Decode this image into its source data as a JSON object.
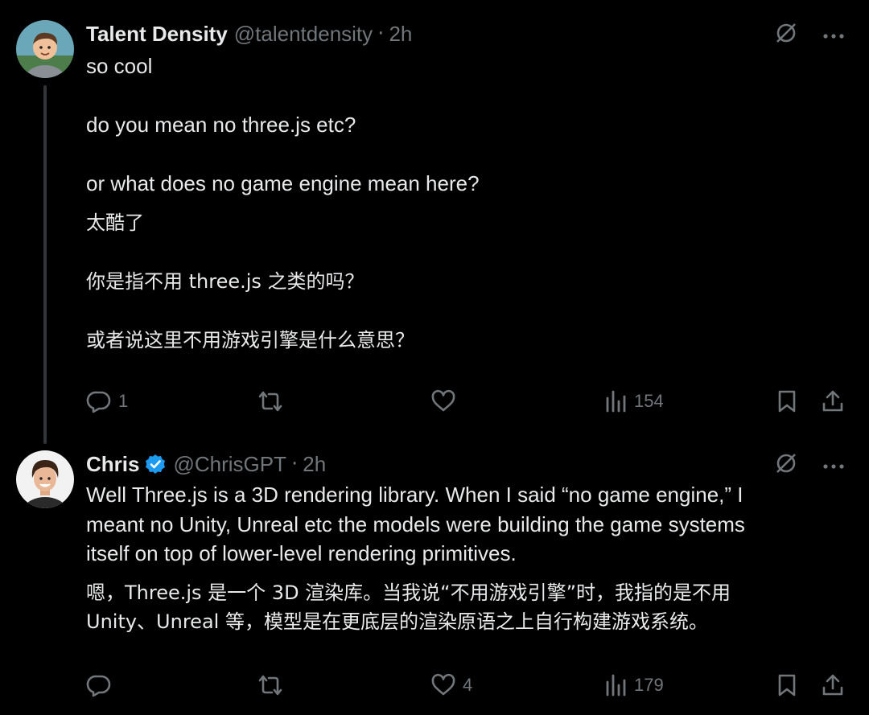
{
  "posts": [
    {
      "author": "Talent Density",
      "handle": "@talentdensity",
      "separator": "·",
      "time": "2h",
      "text_en": "so cool\n\ndo you mean no three.js etc?\n\nor what does no game engine mean here?",
      "text_zh": "太酷了\n\n你是指不用 three.js 之类的吗？\n\n或者说这里不用游戏引擎是什么意思？",
      "replies": "1",
      "reposts": "",
      "likes": "",
      "views": "154"
    },
    {
      "author": "Chris",
      "handle": "@ChrisGPT",
      "separator": "·",
      "time": "2h",
      "verified": true,
      "text_en": "Well Three.js is a 3D rendering library. When I said “no game engine,” I\nmeant no Unity, Unreal etc the models were building the game systems\nitself on top of lower-level rendering primitives.",
      "text_zh": "嗯，Three.js 是一个 3D 渲染库。当我说“不用游戏引擎”时，我指的是不用\nUnity、Unreal 等，模型是在更底层的渲染原语之上自行构建游戏系统。",
      "replies": "",
      "reposts": "",
      "likes": "4",
      "views": "179"
    }
  ],
  "colors": {
    "background": "#000000",
    "text": "#e7e9ea",
    "muted": "#71767b",
    "verified": "#1d9bf0",
    "thread_line": "#333639"
  },
  "icons": [
    "grok-icon",
    "more-icon",
    "reply-icon",
    "repost-icon",
    "like-icon",
    "views-icon",
    "bookmark-icon",
    "share-icon",
    "verified-badge-icon"
  ]
}
